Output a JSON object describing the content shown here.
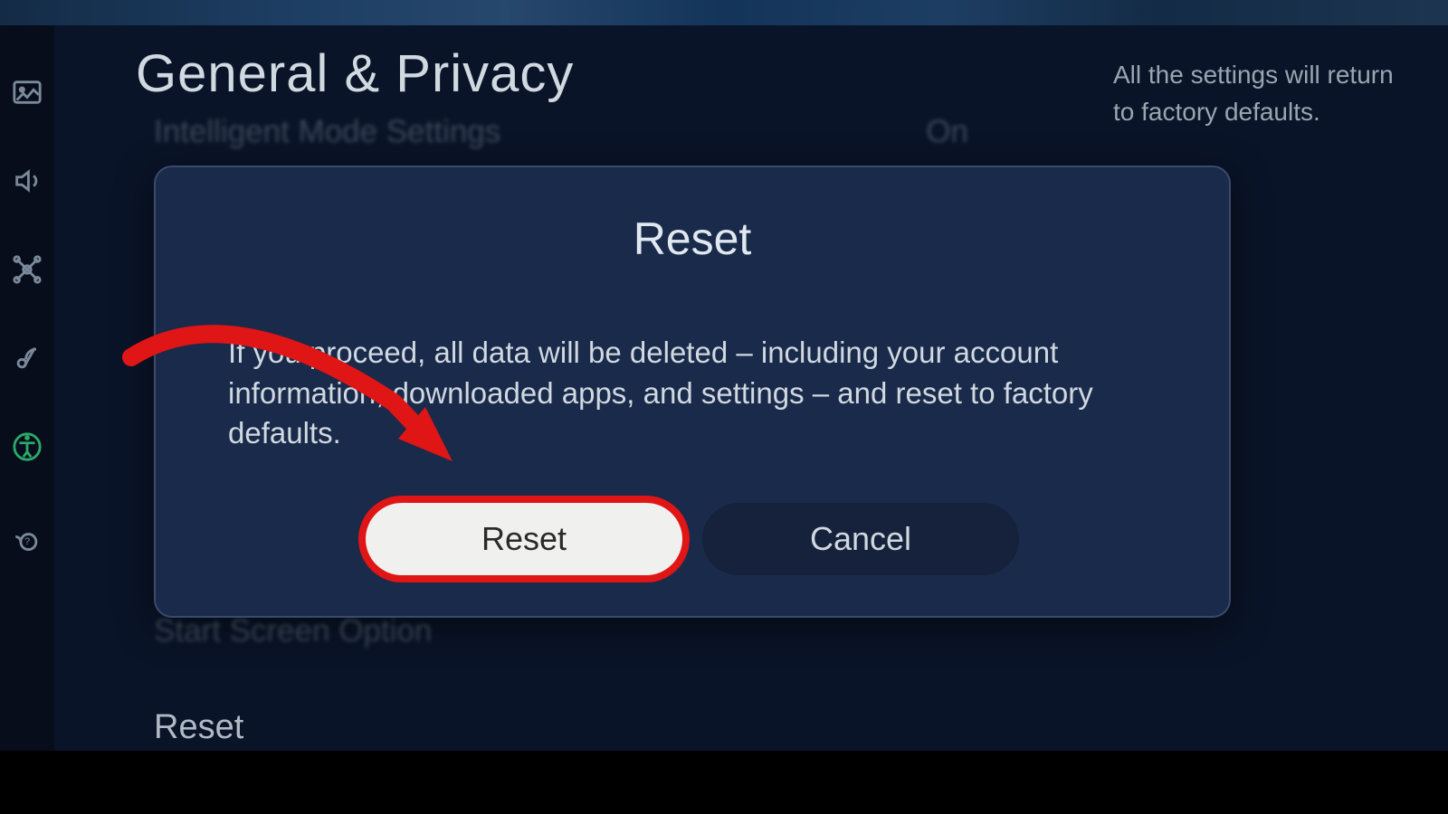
{
  "page": {
    "title": "General & Privacy",
    "description": "All the settings will return to factory defaults."
  },
  "background_rows": {
    "intelligent_mode": {
      "label": "Intelligent Mode Settings",
      "value": "On"
    },
    "start_screen": {
      "label": "Start Screen Option"
    },
    "reset_menu": {
      "label": "Reset"
    }
  },
  "dialog": {
    "title": "Reset",
    "body": "If you proceed, all data will be deleted – including your account information, downloaded apps, and settings – and reset to factory defaults.",
    "reset_label": "Reset",
    "cancel_label": "Cancel"
  },
  "sidebar_icons": {
    "picture": "picture-icon",
    "sound": "sound-icon",
    "connection": "connection-icon",
    "broadcast": "broadcast-icon",
    "accessibility": "accessibility-icon",
    "support": "support-icon"
  }
}
